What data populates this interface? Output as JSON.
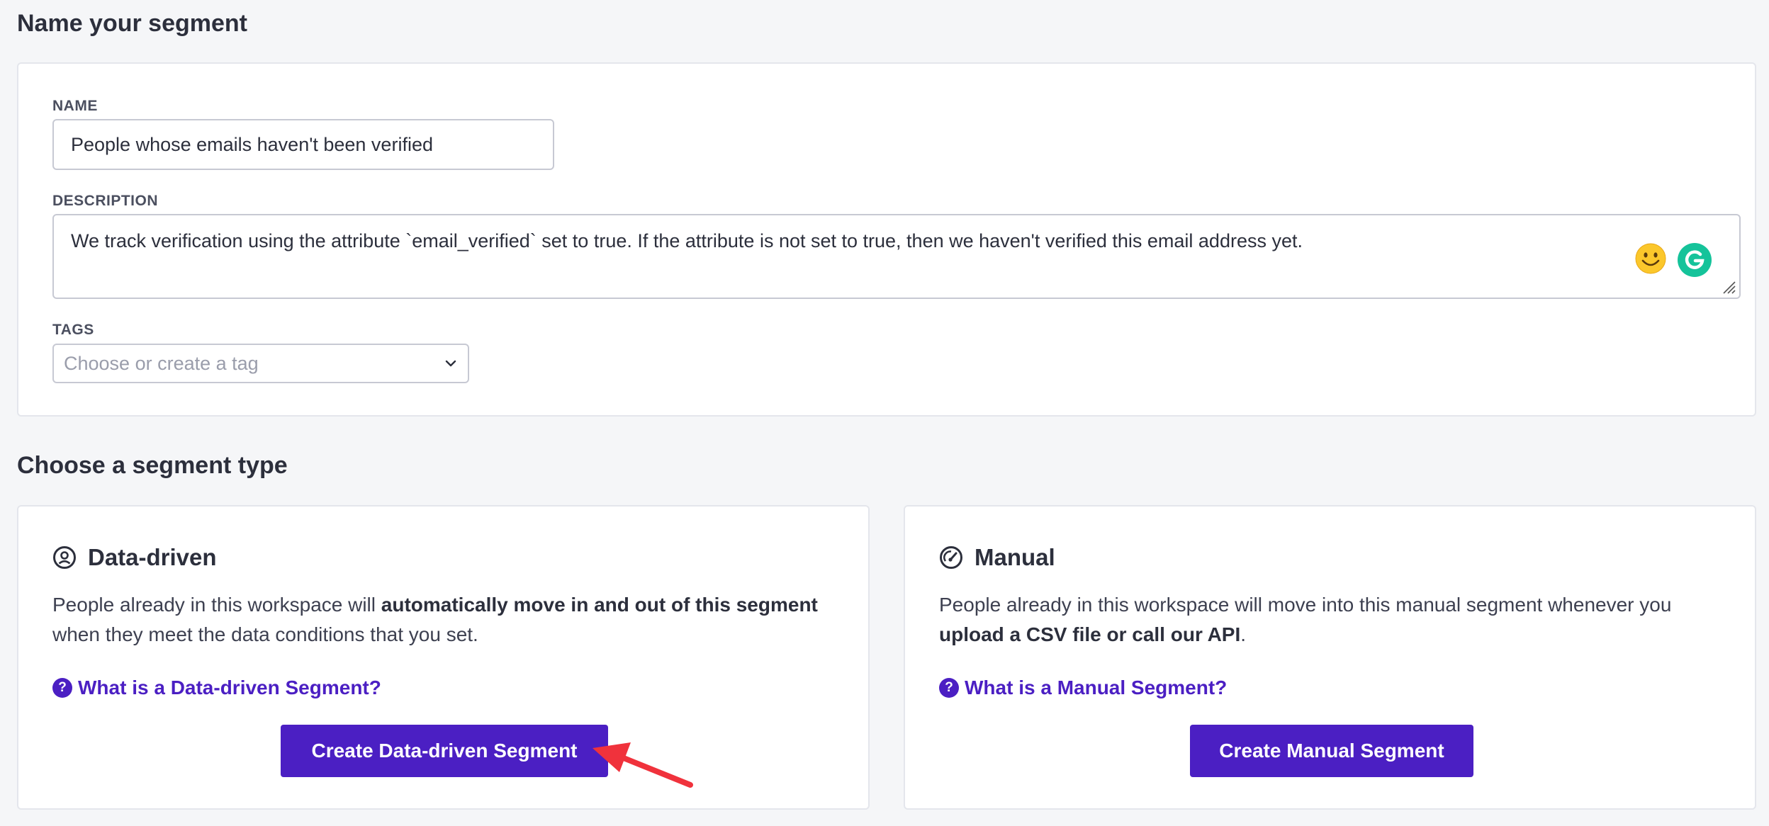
{
  "name_section": {
    "title": "Name your segment",
    "name_label": "NAME",
    "name_value": "People whose emails haven't been verified",
    "description_label": "DESCRIPTION",
    "description_value": "We track verification using the attribute `email_verified` set to true. If the attribute is not set to true, then we haven't verified this email address yet.",
    "tags_label": "TAGS",
    "tags_placeholder": "Choose or create a tag"
  },
  "type_section": {
    "title": "Choose a segment type",
    "data_driven": {
      "title": "Data-driven",
      "desc_pre": "People already in this workspace will ",
      "desc_bold": "automatically move in and out of this segment",
      "desc_post": " when they meet the data conditions that you set.",
      "help_link": "What is a Data-driven Segment?",
      "button": "Create Data-driven Segment"
    },
    "manual": {
      "title": "Manual",
      "desc_pre": "People already in this workspace will move into this manual segment whenever you ",
      "desc_bold": "upload a CSV file or call our API",
      "desc_post": ".",
      "help_link": "What is a Manual Segment?",
      "button": "Create Manual Segment"
    }
  },
  "colors": {
    "accent": "#4b1fc3",
    "annotation_arrow": "#f0323c",
    "background": "#f5f6f8"
  },
  "icons": {
    "data_driven": "user-circle-icon",
    "manual": "gauge-icon",
    "help": "question-icon",
    "emoji": "smiley-emoji-icon",
    "grammarly": "grammarly-icon",
    "dropdown": "chevron-down-icon"
  }
}
